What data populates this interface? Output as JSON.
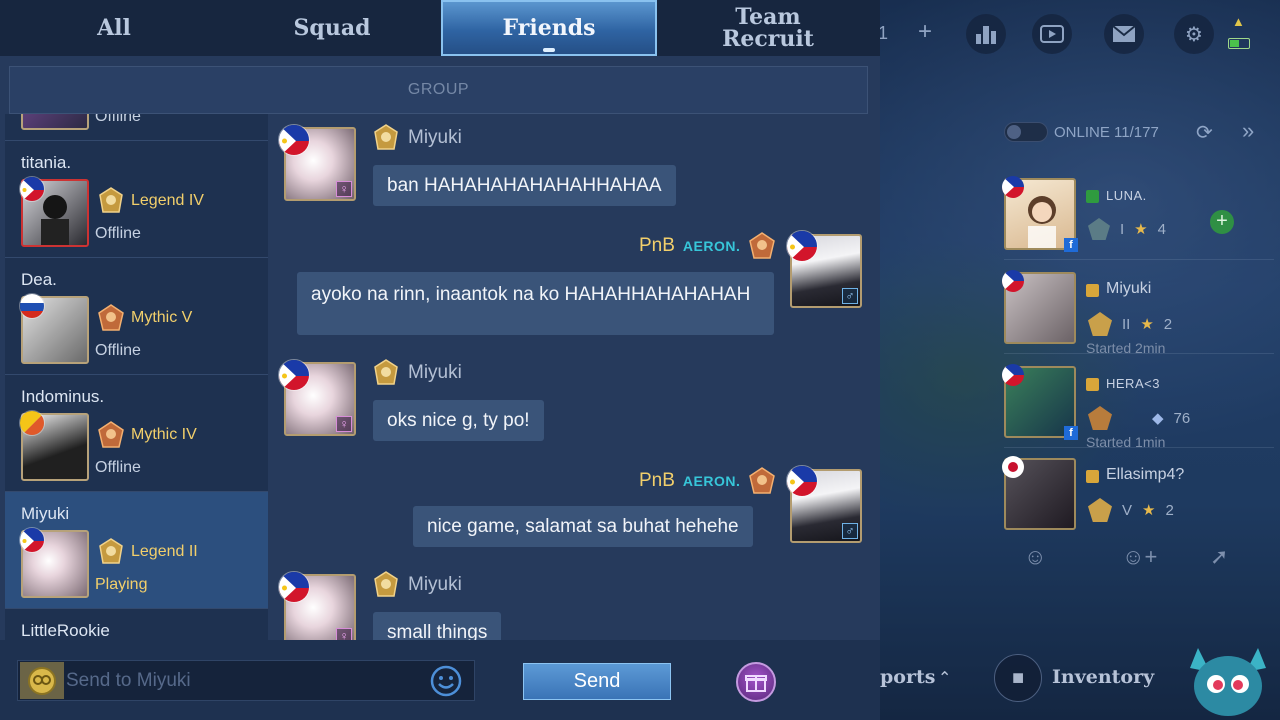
{
  "tabs": [
    {
      "label": "All"
    },
    {
      "label": "Squad"
    },
    {
      "label": "Friends"
    },
    {
      "label": "Team Recruit"
    }
  ],
  "group_label": "GROUP",
  "friend_list": {
    "partial_top_status": "Offline",
    "items": [
      {
        "name": "titania.",
        "rank": "Legend IV",
        "status": "Offline",
        "flag": "PH"
      },
      {
        "name": "Dea.",
        "rank": "Mythic V",
        "status": "Offline",
        "flag": "RU"
      },
      {
        "name": "Indominus.",
        "rank": "Mythic IV",
        "status": "Offline",
        "flag": "BT"
      },
      {
        "name": "Miyuki",
        "rank": "Legend II",
        "status": "Playing",
        "flag": "PH"
      },
      {
        "name": "LittleRookie",
        "rank": "",
        "status": "",
        "flag": ""
      }
    ]
  },
  "chat": {
    "messages": [
      {
        "sender": "Miyuki",
        "text": "ban HAHAHAHAHAHAHHAHAA",
        "mine": false
      },
      {
        "sender": "PnB",
        "tag": "AERON.",
        "text": "ayoko na rinn, inaantok na ko HAHAHHAHAHAHAH",
        "mine": true
      },
      {
        "sender": "Miyuki",
        "text": "oks nice g, ty po!",
        "mine": false
      },
      {
        "sender": "PnB",
        "tag": "AERON.",
        "text": "nice game, salamat sa buhat hehehe",
        "mine": true
      },
      {
        "sender": "Miyuki",
        "text": "small things",
        "mine": false
      }
    ]
  },
  "input": {
    "placeholder": "Send to Miyuki",
    "send_label": "Send"
  },
  "lobby": {
    "top_number": "1",
    "online_text": "ONLINE 11/177",
    "friends": [
      {
        "name": "LUNA.",
        "rank": "I",
        "stars": "4",
        "sub": ""
      },
      {
        "name": "Miyuki",
        "rank": "II",
        "stars": "2",
        "sub": "Started 2min"
      },
      {
        "name": "HERA<3",
        "rank": "",
        "stars": "76",
        "sub": "Started 1min"
      },
      {
        "name": "Ellasimp4?",
        "rank": "V",
        "stars": "2",
        "sub": ""
      }
    ],
    "reports_label": "ports",
    "inventory_label": "Inventory"
  },
  "colors": {
    "panel_bg": "#263a5c",
    "bubble": "#3a5479",
    "rank_gold": "#f2cf6b",
    "tag_cyan": "#37c6d9",
    "send_btn": "#4a86c6"
  }
}
